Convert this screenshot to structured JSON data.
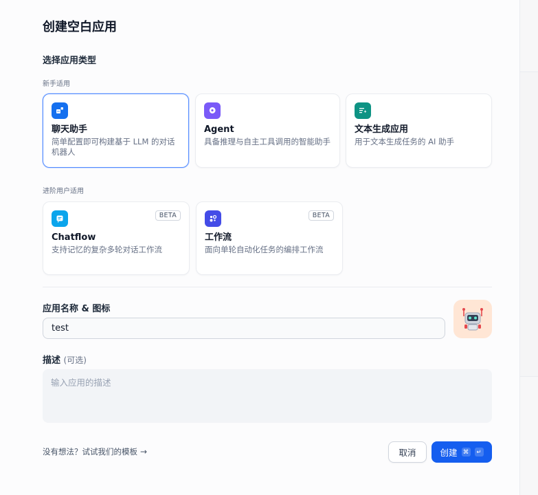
{
  "dialog": {
    "title": "创建空白应用",
    "section_title": "选择应用类型",
    "beginner_label": "新手适用",
    "advanced_label": "进阶用户适用"
  },
  "app_types": {
    "beginner": [
      {
        "name": "聊天助手",
        "desc": "简单配置即可构建基于 LLM 的对话机器人",
        "icon": "chat-bot-icon",
        "color": "#1570ef",
        "selected": true
      },
      {
        "name": "Agent",
        "desc": "具备推理与自主工具调用的智能助手",
        "icon": "agent-icon",
        "color": "#7a5af8",
        "selected": false
      },
      {
        "name": "文本生成应用",
        "desc": "用于文本生成任务的 AI 助手",
        "icon": "text-generation-icon",
        "color": "#0e9384",
        "selected": false
      }
    ],
    "advanced": [
      {
        "name": "Chatflow",
        "desc": "支持记忆的复杂多轮对话工作流",
        "icon": "chatflow-icon",
        "color": "#0ba5ec",
        "badge": "BETA"
      },
      {
        "name": "工作流",
        "desc": "面向单轮自动化任务的编排工作流",
        "icon": "workflow-icon",
        "color": "#444ce7",
        "badge": "BETA"
      }
    ]
  },
  "form": {
    "name_label": "应用名称 & 图标",
    "name_value": "test",
    "avatar_icon": "robot-avatar-icon",
    "avatar_bg": "#ffe6d5",
    "desc_label": "描述",
    "desc_optional": "(可选)",
    "desc_placeholder": "输入应用的描述"
  },
  "footer": {
    "template_link": "没有想法？试试我们的模板",
    "cancel_label": "取消",
    "create_label": "创建",
    "shortcut_cmd": "⌘",
    "shortcut_enter": "↵"
  }
}
